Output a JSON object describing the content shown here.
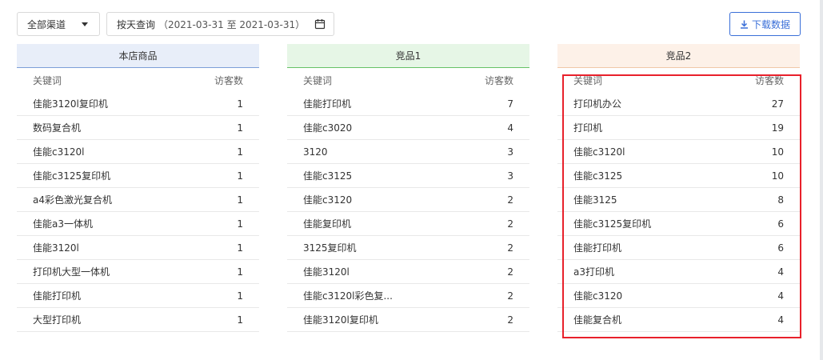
{
  "toolbar": {
    "channel": "全部渠道",
    "date_query_label": "按天查询",
    "date_range": "（2021-03-31 至 2021-03-31）",
    "download_label": "下载数据",
    "accent_color": "#3a6fd8"
  },
  "columns": {
    "keyword": "关键词",
    "visitors": "访客数"
  },
  "panels": [
    {
      "title": "本店商品",
      "rows": [
        {
          "keyword": "佳能3120l复印机",
          "visitors": "1"
        },
        {
          "keyword": "数码复合机",
          "visitors": "1"
        },
        {
          "keyword": "佳能c3120l",
          "visitors": "1"
        },
        {
          "keyword": "佳能c3125复印机",
          "visitors": "1"
        },
        {
          "keyword": "a4彩色激光复合机",
          "visitors": "1"
        },
        {
          "keyword": "佳能a3一体机",
          "visitors": "1"
        },
        {
          "keyword": "佳能3120l",
          "visitors": "1"
        },
        {
          "keyword": "打印机大型一体机",
          "visitors": "1"
        },
        {
          "keyword": "佳能打印机",
          "visitors": "1"
        },
        {
          "keyword": "大型打印机",
          "visitors": "1"
        }
      ]
    },
    {
      "title": "竞品1",
      "rows": [
        {
          "keyword": "佳能打印机",
          "visitors": "7"
        },
        {
          "keyword": "佳能c3020",
          "visitors": "4"
        },
        {
          "keyword": "3120",
          "visitors": "3"
        },
        {
          "keyword": "佳能c3125",
          "visitors": "3"
        },
        {
          "keyword": "佳能c3120",
          "visitors": "2"
        },
        {
          "keyword": "佳能复印机",
          "visitors": "2"
        },
        {
          "keyword": "3125复印机",
          "visitors": "2"
        },
        {
          "keyword": "佳能3120l",
          "visitors": "2"
        },
        {
          "keyword": "佳能c3120l彩色复...",
          "visitors": "2"
        },
        {
          "keyword": "佳能3120l复印机",
          "visitors": "2"
        }
      ]
    },
    {
      "title": "竞品2",
      "rows": [
        {
          "keyword": "打印机办公",
          "visitors": "27"
        },
        {
          "keyword": "打印机",
          "visitors": "19"
        },
        {
          "keyword": "佳能c3120l",
          "visitors": "10"
        },
        {
          "keyword": "佳能c3125",
          "visitors": "10"
        },
        {
          "keyword": "佳能3125",
          "visitors": "8"
        },
        {
          "keyword": "佳能c3125复印机",
          "visitors": "6"
        },
        {
          "keyword": "佳能打印机",
          "visitors": "6"
        },
        {
          "keyword": "a3打印机",
          "visitors": "4"
        },
        {
          "keyword": "佳能c3120",
          "visitors": "4"
        },
        {
          "keyword": "佳能复合机",
          "visitors": "4"
        }
      ]
    }
  ],
  "highlight_color": "#e8212b"
}
